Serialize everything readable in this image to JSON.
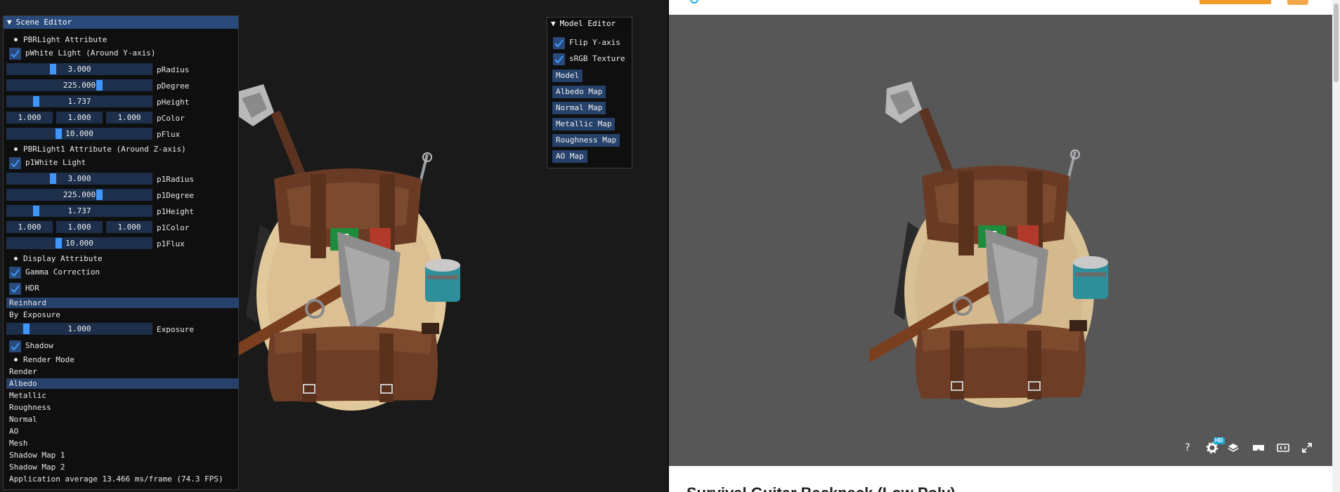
{
  "scene_editor": {
    "title": "Scene Editor",
    "pbr_light_heading": "PBRLight Attribute",
    "light_toggle": "pWhite Light (Around Y-axis)",
    "radius": {
      "value": "3.000",
      "label": "pRadius",
      "fraction": 0.32
    },
    "degree": {
      "value": "225.000",
      "label": "pDegree",
      "fraction": 0.625
    },
    "height": {
      "value": "1.737",
      "label": "pHeight",
      "fraction": 0.2
    },
    "color": {
      "r": "1.000",
      "g": "1.000",
      "b": "1.000",
      "label": "pColor"
    },
    "flux": {
      "value": "10.000",
      "label": "pFlux",
      "fraction": 0.35
    },
    "pbr_light1_heading": "PBRLight1 Attribute (Around Z-axis)",
    "light1_toggle": "p1White Light",
    "radius1": {
      "value": "3.000",
      "label": "p1Radius",
      "fraction": 0.32
    },
    "degree1": {
      "value": "225.000",
      "label": "p1Degree",
      "fraction": 0.625
    },
    "height1": {
      "value": "1.737",
      "label": "p1Height",
      "fraction": 0.2
    },
    "color1": {
      "r": "1.000",
      "g": "1.000",
      "b": "1.000",
      "label": "p1Color"
    },
    "flux1": {
      "value": "10.000",
      "label": "p1Flux",
      "fraction": 0.35
    },
    "display_heading": "Display Attribute",
    "gamma_toggle": "Gamma Correction",
    "hdr_toggle": "HDR",
    "tonemap_options": [
      "Reinhard",
      "By Exposure"
    ],
    "tonemap_selected": "Reinhard",
    "exposure": {
      "value": "1.000",
      "label": "Exposure",
      "fraction": 0.12
    },
    "shadow_toggle": "Shadow",
    "render_mode_heading": "Render Mode",
    "render_modes": [
      "Render",
      "Albedo",
      "Metallic",
      "Roughness",
      "Normal",
      "AO",
      "Mesh",
      "Shadow Map 1",
      "Shadow Map 2"
    ],
    "render_mode_selected": "Albedo",
    "fps_text": "Application average 13.466 ms/frame (74.3 FPS)"
  },
  "model_editor": {
    "title": "Model Editor",
    "flip_y": "Flip Y-axis",
    "srgb": "sRGB Texture",
    "buttons": [
      "Model",
      "Albedo Map",
      "Normal Map",
      "Metallic Map",
      "Roughness Map",
      "AO Map"
    ]
  },
  "web_viewer": {
    "title_partial": "Survival Guitar Backpack (Low Poly)",
    "hd_badge": "HD",
    "help_glyph": "?",
    "icons": [
      "help-icon",
      "settings-icon",
      "layers-icon",
      "vr-icon",
      "embed-icon",
      "fullscreen-icon"
    ]
  },
  "colors": {
    "imgui_title": "#294a7a",
    "imgui_slider": "#1d2f4b",
    "imgui_grab": "#4296fa",
    "imgui_selected": "#26416a",
    "web_accent": "#1caad9",
    "web_orange": "#f09a2a",
    "viewer_bg": "#575757"
  }
}
